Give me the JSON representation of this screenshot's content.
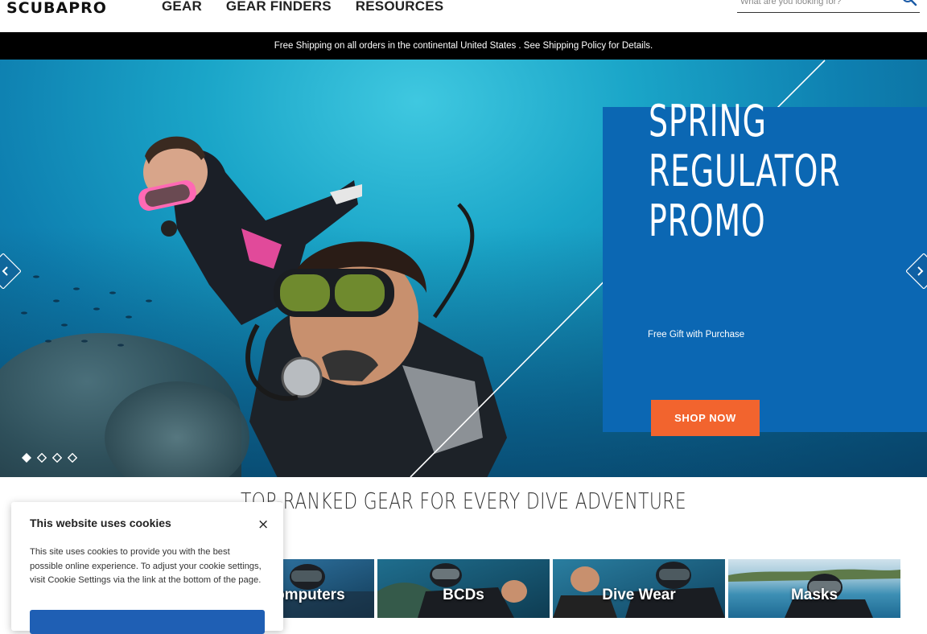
{
  "header": {
    "logo": "SCUBAPRO",
    "nav": [
      "GEAR",
      "GEAR FINDERS",
      "RESOURCES"
    ],
    "search_placeholder": "What are you looking for?"
  },
  "shipping_bar": "Free Shipping on all orders in the continental United States . See Shipping Policy for Details.",
  "hero": {
    "title_line1": "SPRING",
    "title_line2": "REGULATOR",
    "title_line3": "PROMO",
    "subtitle": "Free Gift with Purchase",
    "cta": "SHOP NOW",
    "slide_count": 4,
    "active_slide": 1
  },
  "section": {
    "title": "TOP-RANKED GEAR FOR EVERY DIVE ADVENTURE",
    "categories": [
      "Computers",
      "BCDs",
      "Dive Wear",
      "Masks"
    ]
  },
  "cookie": {
    "title": "This website uses cookies",
    "close": "×",
    "body": "This site uses cookies to provide you with the best possible online experience. To adjust your cookie settings, visit Cookie Settings via the link at the bottom of the page."
  },
  "colors": {
    "accent_orange": "#f2642e",
    "promo_blue": "#0b67b3",
    "cookie_button": "#1f5fb4"
  }
}
